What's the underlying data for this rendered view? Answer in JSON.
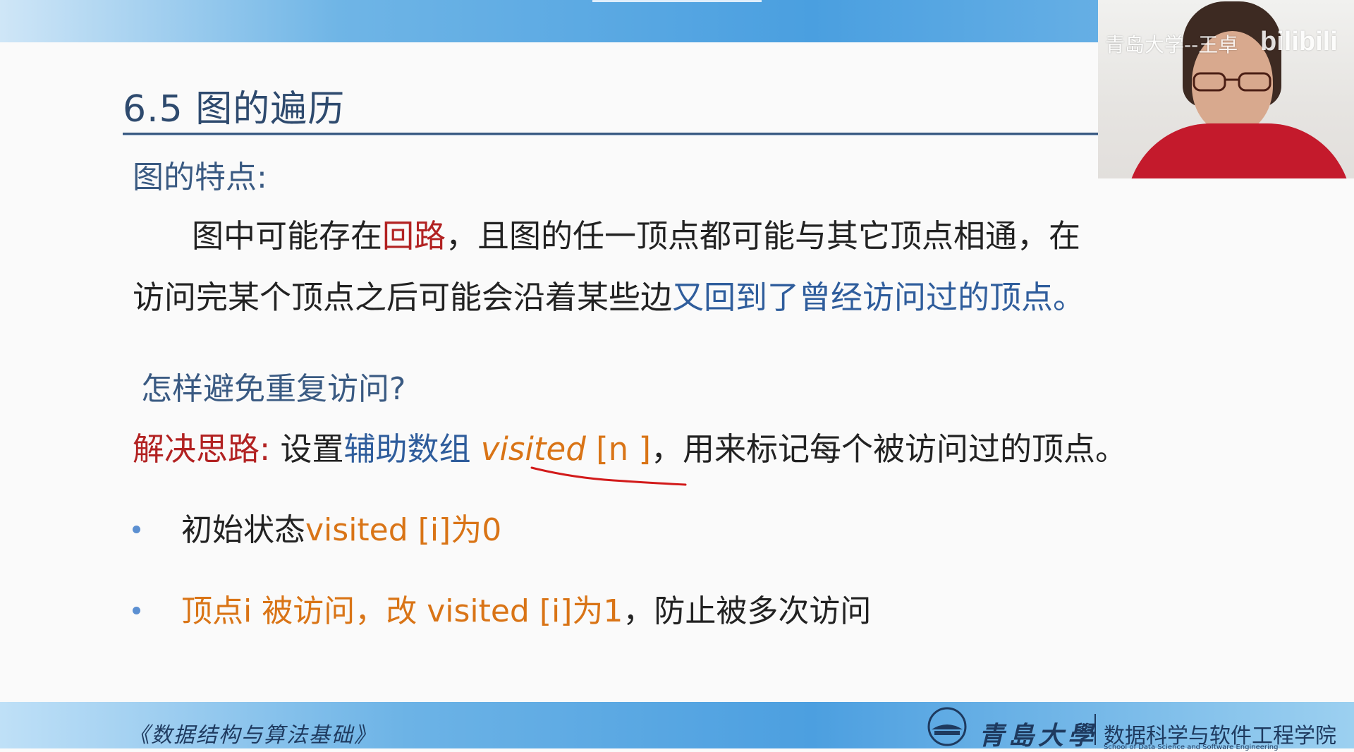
{
  "slide": {
    "title": "6.5 图的遍历",
    "subtitle": "图的特点:",
    "para1": {
      "t1": "图中可能存在",
      "t2": "回路",
      "t3": "，且图的任一顶点都可能与其它顶点相通，在"
    },
    "para2": {
      "t1": "访问完某个顶点之后可能会沿着某些边",
      "t2": "又回到了曾经访问过的顶点。"
    },
    "question": "怎样避免重复访问?",
    "solution": {
      "label": "解决思路:",
      "t1": " 设置",
      "t2": "辅助数组 ",
      "t3": "visited",
      "t4": " [n ]",
      "t5": "，用来标记每个被访问过的顶点。"
    },
    "bullets": [
      {
        "t1": "初始状态",
        "t2": "visited [i]为0",
        "t3": ""
      },
      {
        "t1": "",
        "t2": "顶点i 被访问，改 visited [i]为1",
        "t3": "，防止被多次访问"
      }
    ]
  },
  "webcam": {
    "caption": "青岛大学--王卓",
    "brand": "bilibili"
  },
  "footer": {
    "course": "《数据结构与算法基础》",
    "university": "青島大學",
    "college": "数据科学与软件工程学院",
    "college_en": "School of Data Science and Software Engineering"
  },
  "colors": {
    "red": "#b22222",
    "blue": "#2f5d9c",
    "orange": "#d97416",
    "bar": "#4c9fe0"
  }
}
